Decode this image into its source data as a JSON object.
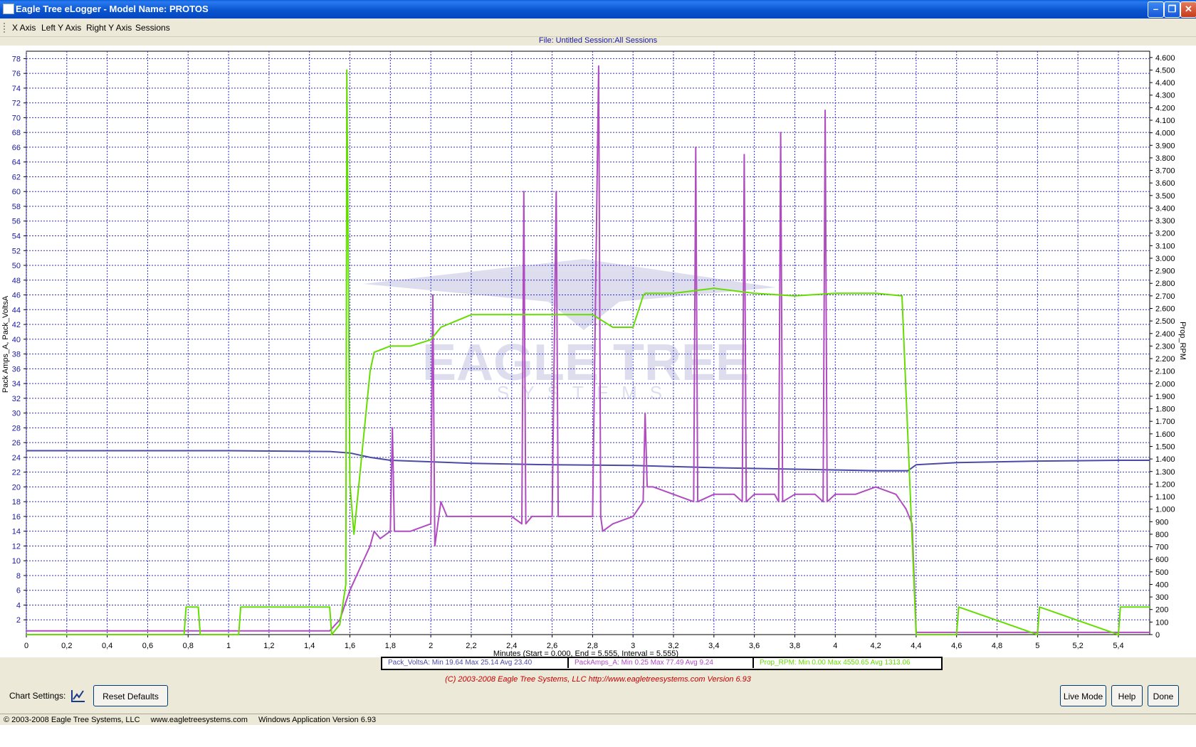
{
  "window": {
    "title": "Eagle Tree eLogger - Model Name: PROTOS"
  },
  "menu": {
    "items": [
      "X Axis",
      "Left Y Axis",
      "Right Y Axis",
      "Sessions"
    ]
  },
  "file_info": "File: Untitled   Session:All Sessions",
  "watermark": {
    "line1": "EAGLE TREE",
    "line2": "SYSTEMS"
  },
  "legend": [
    {
      "label": "Pack_VoltsA:  Min 19.64   Max 25.14   Avg 23.40",
      "color": "#4b4ba6"
    },
    {
      "label": "PackAmps_A:  Min 0.25   Max 77.49   Avg 9.24",
      "color": "#b04cc0"
    },
    {
      "label": "Prop_RPM:  Min 0.00   Max 4550.65   Avg 1313.06",
      "color": "#66dd00"
    }
  ],
  "copyright_line": "(C) 2003-2008 Eagle Tree Systems, LLC     http://www.eagletreesystems.com    Version 6.93",
  "bottom": {
    "chart_settings_label": "Chart Settings:",
    "reset_defaults": "Reset Defaults",
    "live_mode": "Live Mode",
    "help": "Help",
    "done": "Done"
  },
  "status": {
    "copyright": "© 2003-2008 Eagle Tree Systems, LLC",
    "website": "www.eagletreesystems.com",
    "version": "Windows Application Version 6.93"
  },
  "chart_data": {
    "type": "line",
    "xlabel": "Minutes (Start = 0.000,  End = 5.555,  Interval =  5.555)",
    "ylabel_left": "Pack Amps_A, Pack_VoltsA",
    "ylabel_right": "Prop_RPM",
    "xlim": [
      0,
      5.555
    ],
    "ylim_left": [
      0,
      79
    ],
    "ylim_right": [
      0,
      4650
    ],
    "x_ticks": [
      "0",
      "0,2",
      "0,4",
      "0,6",
      "0,8",
      "1",
      "1,2",
      "1,4",
      "1,6",
      "1,8",
      "2",
      "2,2",
      "2,4",
      "2,6",
      "2,8",
      "3",
      "3,2",
      "3,4",
      "3,6",
      "3,8",
      "4",
      "4,2",
      "4,4",
      "4,6",
      "4,8",
      "5",
      "5,2",
      "5,4"
    ],
    "y_left_ticks": [
      "2",
      "4",
      "6",
      "8",
      "10",
      "12",
      "14",
      "16",
      "18",
      "20",
      "22",
      "24",
      "26",
      "28",
      "30",
      "32",
      "34",
      "36",
      "38",
      "40",
      "42",
      "44",
      "46",
      "48",
      "50",
      "52",
      "54",
      "56",
      "58",
      "60",
      "62",
      "64",
      "66",
      "68",
      "70",
      "72",
      "74",
      "76",
      "78"
    ],
    "y_right_ticks": [
      "0",
      "100",
      "200",
      "300",
      "400",
      "500",
      "600",
      "700",
      "800",
      "900",
      "1.000",
      "1.100",
      "1.200",
      "1.300",
      "1.400",
      "1.500",
      "1.600",
      "1.700",
      "1.800",
      "1.900",
      "2.000",
      "2.100",
      "2.200",
      "2.300",
      "2.400",
      "2.500",
      "2.600",
      "2.700",
      "2.800",
      "2.900",
      "3.000",
      "3.100",
      "3.200",
      "3.300",
      "3.400",
      "3.500",
      "3.600",
      "3.700",
      "3.800",
      "3.900",
      "4.000",
      "4.100",
      "4.200",
      "4.300",
      "4.400",
      "4.500",
      "4.600"
    ],
    "grid": true,
    "series": [
      {
        "name": "Pack_VoltsA",
        "axis": "left",
        "color": "#4b4ba6",
        "x": [
          0,
          0.5,
          1.0,
          1.5,
          1.6,
          1.7,
          1.8,
          2.0,
          2.2,
          2.6,
          3.0,
          3.4,
          3.8,
          4.2,
          4.36,
          4.4,
          4.6,
          5.0,
          5.4,
          5.555
        ],
        "y": [
          24.9,
          24.9,
          24.9,
          24.8,
          24.6,
          24.0,
          23.6,
          23.4,
          23.2,
          23.0,
          22.9,
          22.6,
          22.4,
          22.2,
          22.2,
          23.0,
          23.3,
          23.5,
          23.6,
          23.6
        ]
      },
      {
        "name": "PackAmps_A",
        "axis": "left",
        "color": "#b04cc0",
        "x": [
          0,
          1.5,
          1.55,
          1.6,
          1.7,
          1.72,
          1.75,
          1.8,
          1.81,
          1.82,
          1.9,
          2.0,
          2.01,
          2.02,
          2.05,
          2.08,
          2.1,
          2.2,
          2.3,
          2.4,
          2.45,
          2.46,
          2.47,
          2.5,
          2.6,
          2.62,
          2.63,
          2.64,
          2.7,
          2.8,
          2.83,
          2.84,
          2.85,
          2.9,
          3.0,
          3.05,
          3.06,
          3.07,
          3.1,
          3.2,
          3.3,
          3.31,
          3.32,
          3.4,
          3.5,
          3.54,
          3.55,
          3.56,
          3.6,
          3.7,
          3.72,
          3.73,
          3.74,
          3.8,
          3.9,
          3.94,
          3.95,
          3.96,
          4.0,
          4.1,
          4.2,
          4.3,
          4.35,
          4.38,
          4.4,
          4.6,
          5.0,
          5.555
        ],
        "y": [
          0.5,
          0.5,
          2,
          6,
          12,
          14,
          13,
          14,
          28,
          14,
          14,
          15,
          46,
          12,
          18,
          16,
          16,
          16,
          16,
          16,
          15,
          60,
          15,
          16,
          16,
          60,
          16,
          16,
          16,
          16,
          77,
          16,
          14,
          15,
          16,
          18,
          30,
          20,
          20,
          19,
          18,
          66,
          18,
          19,
          19,
          18,
          65,
          18,
          19,
          19,
          18,
          68,
          18,
          19,
          19,
          18,
          71,
          18,
          19,
          19,
          20,
          19,
          17,
          15,
          0.3,
          0.3,
          0.3,
          0.3
        ]
      },
      {
        "name": "Prop_RPM",
        "axis": "right",
        "color": "#66dd00",
        "x": [
          0,
          0.78,
          0.79,
          0.85,
          0.86,
          1.05,
          1.06,
          1.5,
          1.51,
          1.55,
          1.58,
          1.585,
          1.6,
          1.62,
          1.7,
          1.72,
          1.8,
          1.9,
          2.0,
          2.05,
          2.2,
          2.4,
          2.6,
          2.8,
          2.9,
          3.0,
          3.05,
          3.06,
          3.2,
          3.4,
          3.6,
          3.8,
          4.0,
          4.2,
          4.33,
          4.4,
          4.41,
          4.6,
          4.61,
          5.0,
          5.01,
          5.4,
          5.41,
          5.555
        ],
        "y": [
          0,
          0,
          220,
          220,
          0,
          0,
          220,
          220,
          0,
          80,
          400,
          4500,
          1200,
          800,
          2100,
          2250,
          2300,
          2300,
          2350,
          2450,
          2550,
          2550,
          2550,
          2550,
          2450,
          2450,
          2700,
          2720,
          2720,
          2760,
          2720,
          2700,
          2720,
          2720,
          2700,
          0,
          0,
          0,
          220,
          0,
          220,
          0,
          220,
          220
        ]
      }
    ]
  }
}
